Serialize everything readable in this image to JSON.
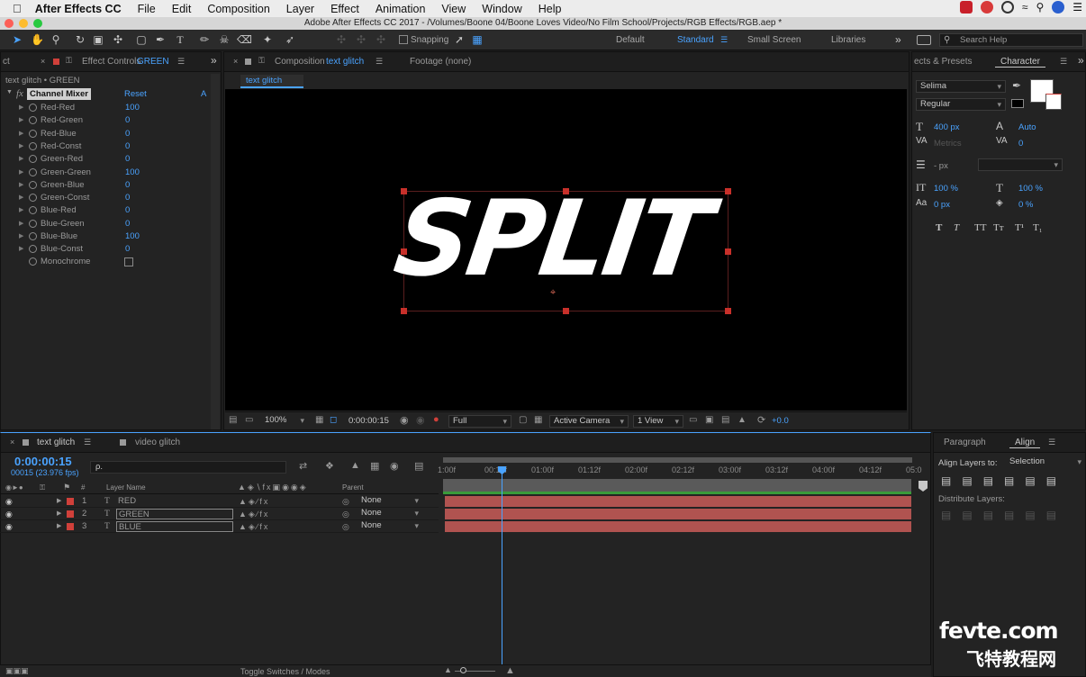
{
  "menubar": {
    "app": "After Effects CC",
    "items": [
      "File",
      "Edit",
      "Composition",
      "Layer",
      "Effect",
      "Animation",
      "View",
      "Window",
      "Help"
    ]
  },
  "window_title": "Adobe After Effects CC 2017 - /Volumes/Boone 04/Boone Loves Video/No Film School/Projects/RGB Effects/RGB.aep *",
  "toolbar": {
    "snapping": "Snapping",
    "workspaces": [
      "Default",
      "Standard",
      "Small Screen",
      "Libraries"
    ],
    "active_workspace": "Standard",
    "search_help": "Search Help"
  },
  "effect_controls": {
    "tab_left": "ct",
    "tab_label": "Effect Controls",
    "tab_layer": "GREEN",
    "subtitle": "text glitch • GREEN",
    "effect_name": "Channel Mixer",
    "reset": "Reset",
    "about": "A",
    "params": [
      {
        "name": "Red-Red",
        "value": "100"
      },
      {
        "name": "Red-Green",
        "value": "0"
      },
      {
        "name": "Red-Blue",
        "value": "0"
      },
      {
        "name": "Red-Const",
        "value": "0"
      },
      {
        "name": "Green-Red",
        "value": "0"
      },
      {
        "name": "Green-Green",
        "value": "100"
      },
      {
        "name": "Green-Blue",
        "value": "0"
      },
      {
        "name": "Green-Const",
        "value": "0"
      },
      {
        "name": "Blue-Red",
        "value": "0"
      },
      {
        "name": "Blue-Green",
        "value": "0"
      },
      {
        "name": "Blue-Blue",
        "value": "100"
      },
      {
        "name": "Blue-Const",
        "value": "0"
      }
    ],
    "monochrome": "Monochrome"
  },
  "composition": {
    "tab_label": "Composition",
    "tab_comp": "text glitch",
    "footage_tab": "Footage (none)",
    "subtab": "text glitch",
    "canvas_text": "SPLIT",
    "zoom": "100%",
    "timecode": "0:00:00:15",
    "resolution": "Full",
    "camera": "Active Camera",
    "views": "1 View",
    "exposure": "+0.0"
  },
  "character": {
    "tab_left": "ects & Presets",
    "tab": "Character",
    "font": "Selima",
    "style": "Regular",
    "size": "400 px",
    "leading": "Auto",
    "kerning": "Metrics",
    "tracking": "0",
    "stroke": "- px",
    "vscale": "100 %",
    "hscale": "100 %",
    "baseline": "0 px",
    "tsume": "0 %",
    "styles": [
      "T",
      "T",
      "TT",
      "Tт",
      "T¹",
      "T₁"
    ]
  },
  "timeline": {
    "tabs": [
      "text glitch",
      "video glitch"
    ],
    "timecode": "0:00:00:15",
    "frames": "00015 (23.976 fps)",
    "search_placeholder": "ρ.",
    "col_layer_name": "Layer Name",
    "col_parent": "Parent",
    "layers": [
      {
        "num": "1",
        "type": "T",
        "name": "RED",
        "parent": "None"
      },
      {
        "num": "2",
        "type": "T",
        "name": "GREEN",
        "parent": "None"
      },
      {
        "num": "3",
        "type": "T",
        "name": "BLUE",
        "parent": "None"
      }
    ],
    "ruler": [
      "1:00f",
      "00:12f",
      "01:00f",
      "01:12f",
      "02:00f",
      "02:12f",
      "03:00f",
      "03:12f",
      "04:00f",
      "04:12f",
      "05:0"
    ],
    "toggle": "Toggle Switches / Modes"
  },
  "align": {
    "tabs": [
      "Paragraph",
      "Align"
    ],
    "align_to_label": "Align Layers to:",
    "align_to_value": "Selection",
    "distribute": "Distribute Layers:"
  },
  "watermark": {
    "line1": "fevte.com",
    "line2": "飞特教程网"
  },
  "colors": {
    "accent": "#4aa3ff",
    "label_red": "#d0403a",
    "layer_bar": "#b05350",
    "bg": "#232323"
  }
}
